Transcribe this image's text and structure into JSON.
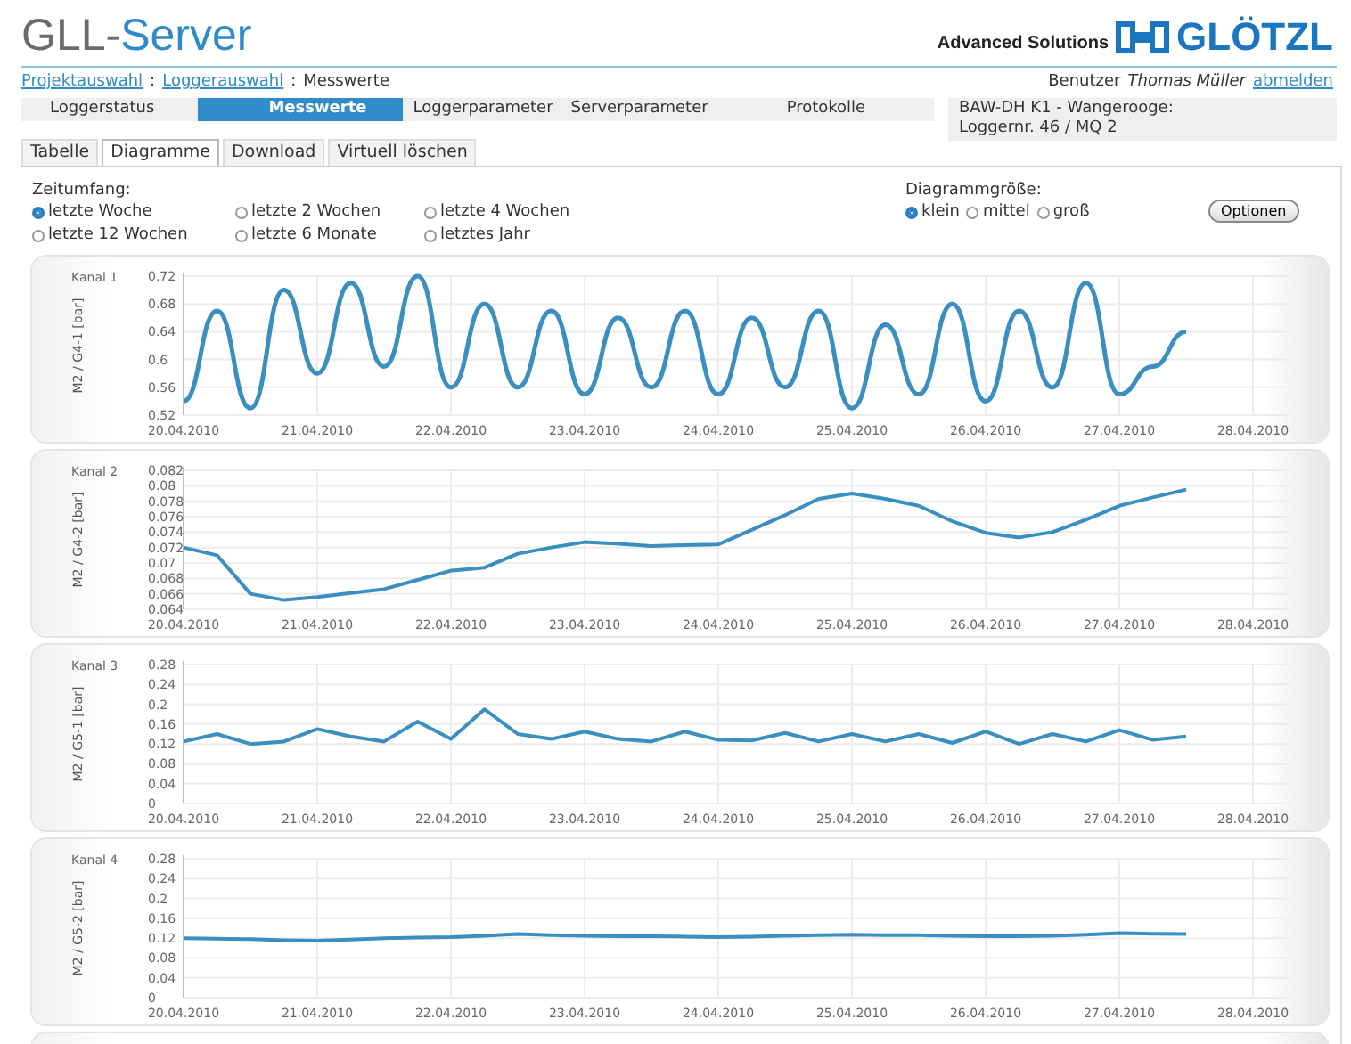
{
  "header": {
    "title_prefix": "GLL-",
    "title_suffix": "Server",
    "tagline": "Advanced Solutions",
    "brand": "GLÖTZL"
  },
  "breadcrumb": [
    {
      "label": "Projektauswahl",
      "kind": "link"
    },
    {
      "label": "Loggerauswahl",
      "kind": "link"
    },
    {
      "label": "Messwerte",
      "kind": "current"
    }
  ],
  "breadcrumb_separator": ":",
  "user": {
    "label": "Benutzer",
    "name": "Thomas Müller",
    "logout": "abmelden"
  },
  "nav_tabs": [
    {
      "label": "Loggerstatus",
      "selected": false
    },
    {
      "label": "Messwerte",
      "selected": true
    },
    {
      "label": "Loggerparameter",
      "selected": false
    },
    {
      "label": "Serverparameter",
      "selected": false
    },
    {
      "label": "Protokolle",
      "selected": false
    }
  ],
  "logger_info": [
    "BAW-DH K1 - Wangerooge:",
    "Loggernr. 46 / MQ 2"
  ],
  "sub_tabs": [
    {
      "label": "Tabelle",
      "selected": false
    },
    {
      "label": "Diagramme",
      "selected": true
    },
    {
      "label": "Download",
      "selected": false
    },
    {
      "label": "Virtuell löschen",
      "selected": false
    }
  ],
  "time_range": {
    "label": "Zeitumfang:",
    "options": [
      {
        "label": "letzte Woche",
        "selected": true
      },
      {
        "label": "letzte 2 Wochen",
        "selected": false
      },
      {
        "label": "letzte 4 Wochen",
        "selected": false
      },
      {
        "label": "letzte 12 Wochen",
        "selected": false
      },
      {
        "label": "letzte 6 Monate",
        "selected": false
      },
      {
        "label": "letztes Jahr",
        "selected": false
      }
    ]
  },
  "chart_size": {
    "label": "Diagrammgröße:",
    "options": [
      {
        "label": "klein",
        "selected": true
      },
      {
        "label": "mittel",
        "selected": false
      },
      {
        "label": "groß",
        "selected": false
      }
    ]
  },
  "options_button": "Optionen",
  "charts": [
    {
      "chart_data": {
        "type": "line",
        "grid": true,
        "title": "Kanal 1",
        "ylabel": "M2 / G4-1 [bar]",
        "ylim": [
          0.52,
          0.72
        ],
        "categories": [
          "20.04.2010",
          null,
          null,
          null,
          "21.04.2010",
          null,
          null,
          null,
          "22.04.2010",
          null,
          null,
          null,
          "23.04.2010",
          null,
          null,
          null,
          "24.04.2010",
          null,
          null,
          null,
          "25.04.2010",
          null,
          null,
          null,
          "26.04.2010",
          null,
          null,
          null,
          "27.04.2010",
          null,
          null,
          null,
          "28.04.2010"
        ],
        "yticks": [
          0.52,
          0.56,
          0.6,
          0.64,
          0.68,
          0.72
        ],
        "series": [
          {
            "color": "#3a8fc0",
            "values": [
              0.54,
              0.67,
              0.53,
              0.7,
              0.58,
              0.71,
              0.59,
              0.72,
              0.56,
              0.68,
              0.56,
              0.67,
              0.55,
              0.66,
              0.56,
              0.67,
              0.55,
              0.66,
              0.56,
              0.67,
              0.53,
              0.65,
              0.55,
              0.68,
              0.54,
              0.67,
              0.56,
              0.71,
              0.55,
              0.59,
              0.64,
              null,
              null
            ]
          }
        ]
      }
    },
    {
      "chart_data": {
        "type": "line",
        "grid": true,
        "title": "Kanal 2",
        "ylabel": "M2 / G4-2 [bar]",
        "ylim": [
          0.064,
          0.082
        ],
        "categories": [
          "20.04.2010",
          null,
          null,
          null,
          "21.04.2010",
          null,
          null,
          null,
          "22.04.2010",
          null,
          null,
          null,
          "23.04.2010",
          null,
          null,
          null,
          "24.04.2010",
          null,
          null,
          null,
          "25.04.2010",
          null,
          null,
          null,
          "26.04.2010",
          null,
          null,
          null,
          "27.04.2010",
          null,
          null,
          null,
          "28.04.2010"
        ],
        "yticks": [
          0.064,
          0.066,
          0.068,
          0.07,
          0.072,
          0.074,
          0.076,
          0.078,
          0.08,
          0.082
        ],
        "series": [
          {
            "color": "#3a8fc0",
            "values": [
              0.072,
              0.071,
              0.066,
              0.0652,
              0.0656,
              0.0661,
              0.0666,
              0.0678,
              0.069,
              0.0694,
              0.0712,
              0.072,
              0.0727,
              0.0725,
              0.0722,
              0.0723,
              0.0724,
              0.0743,
              0.0762,
              0.0783,
              0.079,
              0.0783,
              0.0774,
              0.0754,
              0.0739,
              0.0733,
              0.074,
              0.0756,
              0.0774,
              0.0785,
              0.0795,
              null,
              null
            ]
          }
        ]
      }
    },
    {
      "chart_data": {
        "type": "line",
        "grid": true,
        "title": "Kanal 3",
        "ylabel": "M2 / G5-1 [bar]",
        "ylim": [
          0,
          0.28
        ],
        "categories": [
          "20.04.2010",
          null,
          null,
          null,
          "21.04.2010",
          null,
          null,
          null,
          "22.04.2010",
          null,
          null,
          null,
          "23.04.2010",
          null,
          null,
          null,
          "24.04.2010",
          null,
          null,
          null,
          "25.04.2010",
          null,
          null,
          null,
          "26.04.2010",
          null,
          null,
          null,
          "27.04.2010",
          null,
          null,
          null,
          "28.04.2010"
        ],
        "yticks": [
          0,
          0.04,
          0.08,
          0.12,
          0.16,
          0.2,
          0.24,
          0.28
        ],
        "series": [
          {
            "color": "#3a8fc0",
            "values": [
              0.125,
              0.14,
              0.12,
              0.125,
              0.15,
              0.135,
              0.125,
              0.165,
              0.13,
              0.19,
              0.14,
              0.13,
              0.145,
              0.13,
              0.125,
              0.145,
              0.128,
              0.127,
              0.142,
              0.125,
              0.14,
              0.125,
              0.14,
              0.122,
              0.145,
              0.12,
              0.14,
              0.125,
              0.148,
              0.128,
              0.135,
              null,
              null
            ]
          }
        ]
      }
    },
    {
      "chart_data": {
        "type": "line",
        "grid": true,
        "title": "Kanal 4",
        "ylabel": "M2 / G5-2 [bar]",
        "ylim": [
          0,
          0.28
        ],
        "categories": [
          "20.04.2010",
          null,
          null,
          null,
          "21.04.2010",
          null,
          null,
          null,
          "22.04.2010",
          null,
          null,
          null,
          "23.04.2010",
          null,
          null,
          null,
          "24.04.2010",
          null,
          null,
          null,
          "25.04.2010",
          null,
          null,
          null,
          "26.04.2010",
          null,
          null,
          null,
          "27.04.2010",
          null,
          null,
          null,
          "28.04.2010"
        ],
        "yticks": [
          0,
          0.04,
          0.08,
          0.12,
          0.16,
          0.2,
          0.24,
          0.28
        ],
        "series": [
          {
            "color": "#3a8fc0",
            "values": [
              0.12,
              0.119,
              0.118,
              0.116,
              0.115,
              0.117,
              0.12,
              0.121,
              0.122,
              0.125,
              0.128,
              0.126,
              0.125,
              0.124,
              0.124,
              0.123,
              0.122,
              0.123,
              0.125,
              0.126,
              0.127,
              0.126,
              0.126,
              0.125,
              0.124,
              0.124,
              0.125,
              0.127,
              0.13,
              0.129,
              0.128,
              null,
              null
            ]
          }
        ]
      }
    }
  ]
}
